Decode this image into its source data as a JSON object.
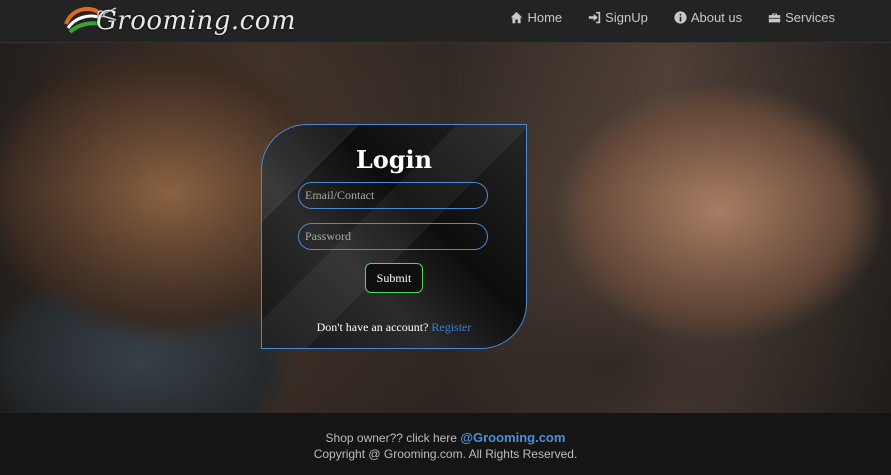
{
  "brand": {
    "logo_text": "Grooming.com"
  },
  "nav": {
    "items": [
      {
        "label": "Home",
        "icon": "home-icon"
      },
      {
        "label": "SignUp",
        "icon": "sign-in-icon"
      },
      {
        "label": "About us",
        "icon": "info-icon"
      },
      {
        "label": "Services",
        "icon": "briefcase-icon"
      }
    ]
  },
  "login": {
    "title": "Login",
    "email_placeholder": "Email/Contact",
    "password_placeholder": "Password",
    "submit_label": "Submit",
    "register_prompt": "Don't have an account?",
    "register_link": "Register"
  },
  "footer": {
    "shop_owner_text": "Shop owner?? click here",
    "shop_owner_link": "@Grooming.com",
    "copyright": "Copyright @ Grooming.com. All Rights Reserved."
  },
  "colors": {
    "accent_blue": "#4b8ad6",
    "submit_border": "#4cd964",
    "navbar_bg": "#232323",
    "footer_bg": "#151515"
  }
}
